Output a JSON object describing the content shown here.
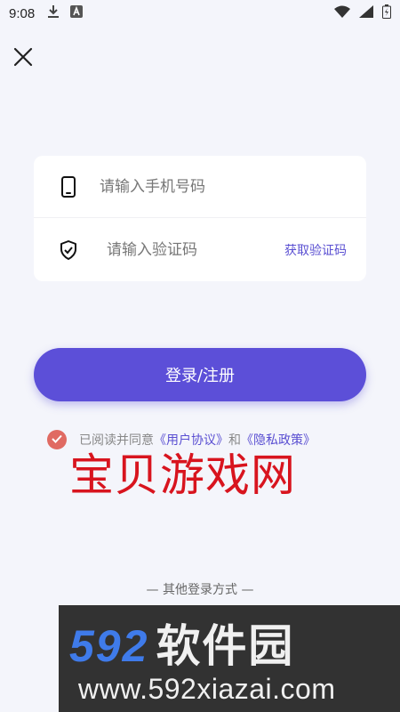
{
  "status_bar": {
    "time": "9:08"
  },
  "form": {
    "phone_placeholder": "请输入手机号码",
    "code_placeholder": "请输入验证码",
    "get_code_label": "获取验证码"
  },
  "login_button_label": "登录/注册",
  "agreement": {
    "prefix": "已阅读并同意",
    "user_agreement": "《用户协议》",
    "conjunction": "和",
    "privacy_policy": "《隐私政策》",
    "checked": true
  },
  "watermark_text": "宝贝游戏网",
  "other_login_label": "— 其他登录方式 —",
  "banner": {
    "number": "592",
    "name": "软件园",
    "url": "www.592xiazai.com"
  },
  "colors": {
    "accent": "#5c4fd8",
    "link": "#5a4fd2",
    "check": "#e06a62",
    "watermark": "#d8141e"
  },
  "icons": [
    "download-icon",
    "a-box-icon",
    "wifi-icon",
    "signal-icon",
    "battery-icon",
    "close-icon",
    "phone-icon",
    "shield-check-icon",
    "check-icon"
  ]
}
